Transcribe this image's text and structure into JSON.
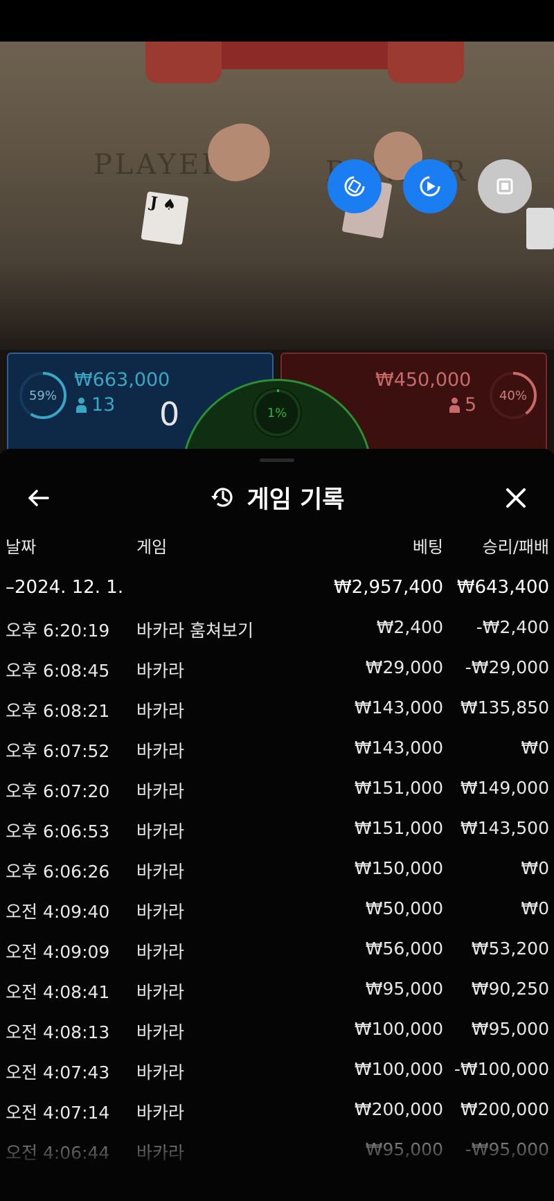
{
  "video": {
    "table_player_text": "PLAYER",
    "table_banker_text": "BANKER",
    "card_rank": "J",
    "buttons": [
      {
        "name": "rotate-button",
        "icon": "rotate-icon"
      },
      {
        "name": "replay-button",
        "icon": "replay-icon"
      },
      {
        "name": "stop-button",
        "icon": "stop-icon"
      }
    ]
  },
  "bets": {
    "player": {
      "percent": "59%",
      "amount": "₩663,000",
      "count": "13",
      "score": "0",
      "percent_value": 0.59,
      "color": "#3aa7c2"
    },
    "tie": {
      "percent": "1%",
      "percent_value": 0.01,
      "color": "#2fb13a"
    },
    "banker": {
      "percent": "40%",
      "amount": "₩450,000",
      "count": "5",
      "percent_value": 0.4,
      "color": "#c96a6a"
    }
  },
  "history": {
    "title": "게임 기록",
    "headers": {
      "date": "날짜",
      "game": "게임",
      "bet": "베팅",
      "win": "승리/패배"
    },
    "date_row": {
      "date": "–2024. 12. 1.",
      "bet": "₩2,957,400",
      "win": "₩643,400"
    },
    "rows": [
      {
        "time": "오후 6:20:19",
        "game": "바카라 훔쳐보기",
        "bet": "₩2,400",
        "win": "-₩2,400"
      },
      {
        "time": "오후 6:08:45",
        "game": "바카라",
        "bet": "₩29,000",
        "win": "-₩29,000"
      },
      {
        "time": "오후 6:08:21",
        "game": "바카라",
        "bet": "₩143,000",
        "win": "₩135,850"
      },
      {
        "time": "오후 6:07:52",
        "game": "바카라",
        "bet": "₩143,000",
        "win": "₩0"
      },
      {
        "time": "오후 6:07:20",
        "game": "바카라",
        "bet": "₩151,000",
        "win": "₩149,000"
      },
      {
        "time": "오후 6:06:53",
        "game": "바카라",
        "bet": "₩151,000",
        "win": "₩143,500"
      },
      {
        "time": "오후 6:06:26",
        "game": "바카라",
        "bet": "₩150,000",
        "win": "₩0"
      },
      {
        "time": "오전 4:09:40",
        "game": "바카라",
        "bet": "₩50,000",
        "win": "₩0"
      },
      {
        "time": "오전 4:09:09",
        "game": "바카라",
        "bet": "₩56,000",
        "win": "₩53,200"
      },
      {
        "time": "오전 4:08:41",
        "game": "바카라",
        "bet": "₩95,000",
        "win": "₩90,250"
      },
      {
        "time": "오전 4:08:13",
        "game": "바카라",
        "bet": "₩100,000",
        "win": "₩95,000"
      },
      {
        "time": "오전 4:07:43",
        "game": "바카라",
        "bet": "₩100,000",
        "win": "-₩100,000"
      },
      {
        "time": "오전 4:07:14",
        "game": "바카라",
        "bet": "₩200,000",
        "win": "₩200,000"
      },
      {
        "time": "오전 4:06:44",
        "game": "바카라",
        "bet": "₩95,000",
        "win": "-₩95,000"
      }
    ]
  }
}
